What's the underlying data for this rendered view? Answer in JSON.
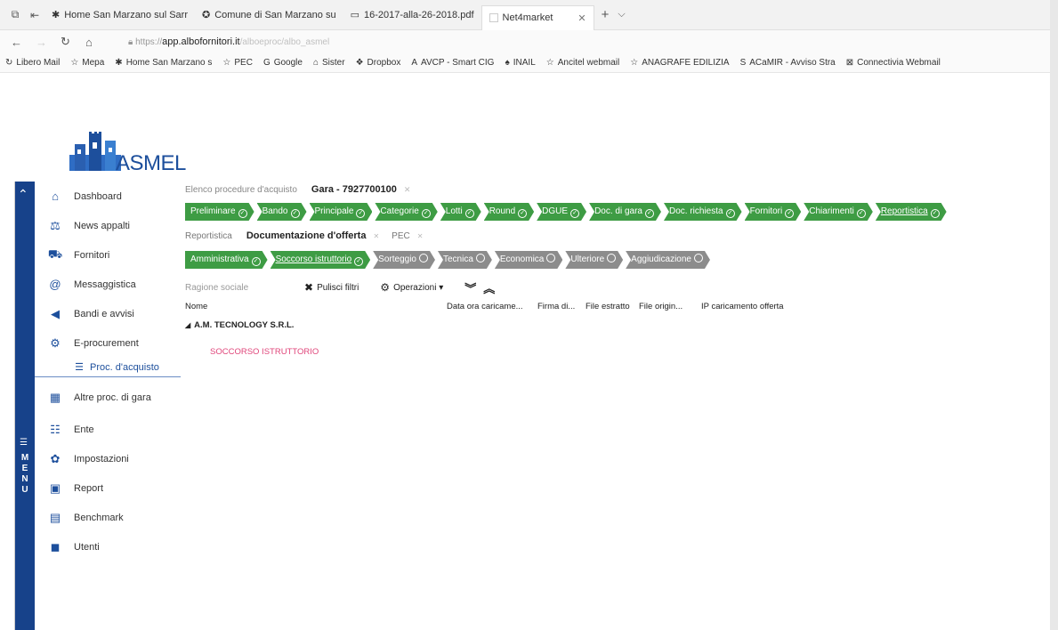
{
  "browser": {
    "tabs": [
      {
        "icon": "✱",
        "label": "Home San Marzano sul Sarr"
      },
      {
        "icon": "✪",
        "label": "Comune di San Marzano su"
      },
      {
        "icon": "▭",
        "label": "16-2017-alla-26-2018.pdf"
      },
      {
        "icon": "",
        "label": "Net4market"
      }
    ],
    "active_tab_index": 3,
    "url_prefix": "https://",
    "url_domain": "app.albofornitori.it",
    "url_path": "/alboeproc/albo_asmel",
    "bookmarks": [
      {
        "icon": "↻",
        "label": "Libero Mail"
      },
      {
        "icon": "☆",
        "label": "Mepa"
      },
      {
        "icon": "✱",
        "label": "Home San Marzano s"
      },
      {
        "icon": "☆",
        "label": "PEC"
      },
      {
        "icon": "G",
        "label": "Google"
      },
      {
        "icon": "⌂",
        "label": "Sister"
      },
      {
        "icon": "❖",
        "label": "Dropbox"
      },
      {
        "icon": "A",
        "label": "AVCP - Smart CIG"
      },
      {
        "icon": "♠",
        "label": "INAIL"
      },
      {
        "icon": "☆",
        "label": "Ancitel webmail"
      },
      {
        "icon": "☆",
        "label": "ANAGRAFE EDILIZIA"
      },
      {
        "icon": "S",
        "label": "ACaMIR - Avviso Stra"
      },
      {
        "icon": "⊠",
        "label": "Connectivia Webmail"
      }
    ]
  },
  "app": {
    "brand": "ASMEL",
    "menu_label": "MENU",
    "nav": [
      {
        "icon": "⌂",
        "label": "Dashboard"
      },
      {
        "icon": "⚖",
        "label": "News appalti"
      },
      {
        "icon": "⛟",
        "label": "Fornitori"
      },
      {
        "icon": "@",
        "label": "Messaggistica"
      },
      {
        "icon": "◀",
        "label": "Bandi e avvisi"
      },
      {
        "icon": "⚙",
        "label": "E-procurement"
      },
      {
        "icon": "☰",
        "label": "Proc. d'acquisto",
        "sub": true
      },
      {
        "icon": "▦",
        "label": "Altre proc. di gara"
      },
      {
        "icon": "☷",
        "label": "Ente"
      },
      {
        "icon": "✿",
        "label": "Impostazioni"
      },
      {
        "icon": "▣",
        "label": "Report"
      },
      {
        "icon": "▤",
        "label": "Benchmark"
      },
      {
        "icon": "◼",
        "label": "Utenti"
      }
    ]
  },
  "main": {
    "breadcrumb": "Elenco procedure d'acquisto",
    "gara": "Gara - 7927700100",
    "steps": [
      "Preliminare",
      "Bando",
      "Principale",
      "Categorie",
      "Lotti",
      "Round",
      "DGUE",
      "Doc. di gara",
      "Doc. richiesta",
      "Fornitori",
      "Chiarimenti",
      "Reportistica"
    ],
    "subtabs": [
      "Reportistica",
      "Documentazione d'offerta",
      "PEC"
    ],
    "active_subtab": 1,
    "substeps": [
      {
        "label": "Amministrativa",
        "state": "done"
      },
      {
        "label": "Soccorso istruttorio",
        "state": "done"
      },
      {
        "label": "Sorteggio",
        "state": "pending"
      },
      {
        "label": "Tecnica",
        "state": "pending"
      },
      {
        "label": "Economica",
        "state": "pending"
      },
      {
        "label": "Ulteriore",
        "state": "pending"
      },
      {
        "label": "Aggiudicazione",
        "state": "pending"
      }
    ],
    "filter_placeholder": "Ragione sociale",
    "clear_filters": "Pulisci filtri",
    "operations": "Operazioni ▾",
    "columns": [
      "Nome",
      "Data ora caricame...",
      "Firma di...",
      "File estratto",
      "File origin...",
      "IP caricamento offerta"
    ],
    "group_name": "A.M. TECNOLOGY S.R.L.",
    "group_item": "SOCCORSO ISTRUTTORIO"
  }
}
